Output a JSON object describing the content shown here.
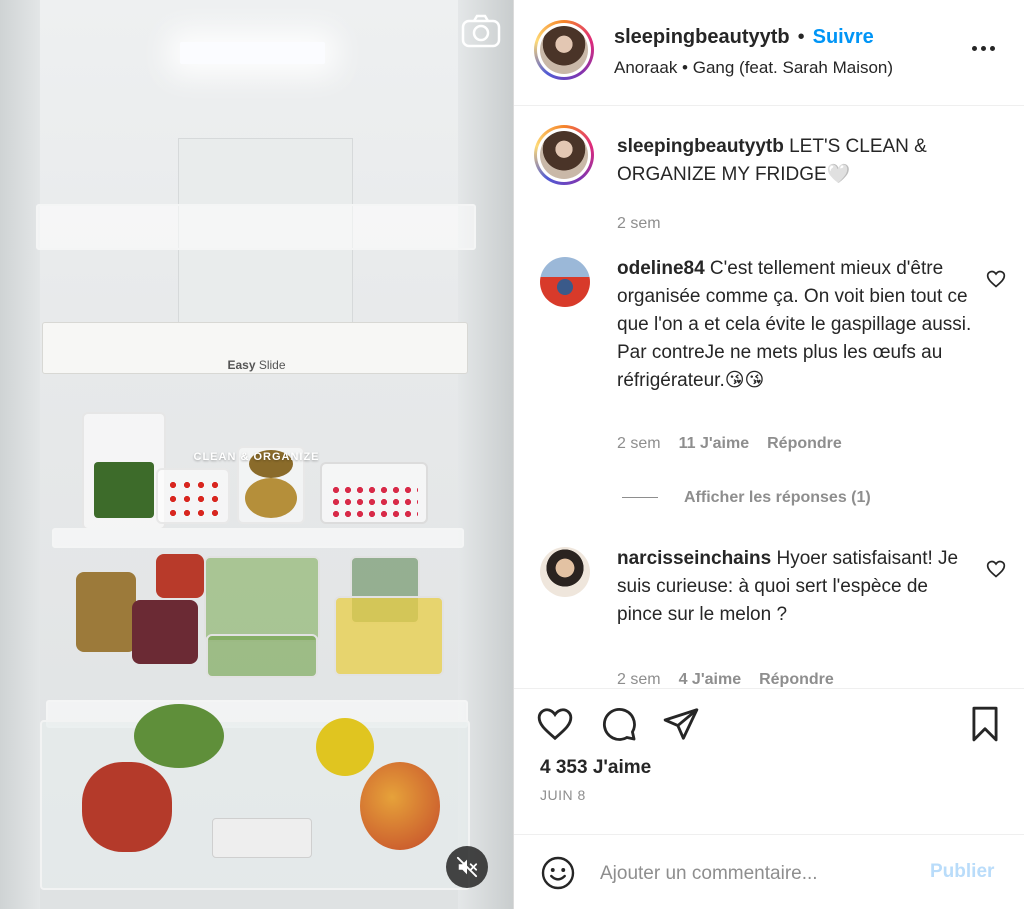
{
  "media": {
    "easy_slide_bold": "Easy",
    "easy_slide_thin": " Slide",
    "overlay_text": "CLEAN & ORGANIZE"
  },
  "header": {
    "username": "sleepingbeautyytb",
    "separator": "•",
    "follow_label": "Suivre",
    "audio": "Anoraak • Gang (feat. Sarah Maison)"
  },
  "caption": {
    "username": "sleepingbeautyytb",
    "text": " LET'S CLEAN & ORGANIZE MY FRIDGE🤍",
    "time": "2 sem"
  },
  "comments": [
    {
      "username": "odeline84",
      "text": " C'est tellement mieux d'être organisée comme ça. On voit bien tout ce que l'on a et cela évite le gaspillage aussi. Par contreJe ne mets plus les œufs au réfrigérateur.😘😘",
      "time": "2 sem",
      "likes": "11 J'aime",
      "reply": "Répondre",
      "view_replies": "Afficher les réponses (1)"
    },
    {
      "username": "narcisseinchains",
      "text": " Hyoer satisfaisant! Je suis curieuse: à quoi sert l'espèce de pince sur le melon ?",
      "time": "2 sem",
      "likes": "4 J'aime",
      "reply": "Répondre"
    }
  ],
  "actions": {
    "likes": "4 353 J'aime",
    "date": "JUIN 8"
  },
  "add_comment": {
    "placeholder": "Ajouter un commentaire...",
    "publish": "Publier"
  },
  "icons": {
    "camera": "camera-icon",
    "mute": "speaker-muted-icon",
    "more": "more-options-icon",
    "like": "heart-icon",
    "comment": "comment-bubble-icon",
    "share": "paper-plane-icon",
    "save": "bookmark-icon",
    "emoji": "smiley-icon"
  },
  "colors": {
    "accent": "#0095f6",
    "publish_disabled": "#b9dcfa",
    "muted_text": "#8e8e8e"
  }
}
